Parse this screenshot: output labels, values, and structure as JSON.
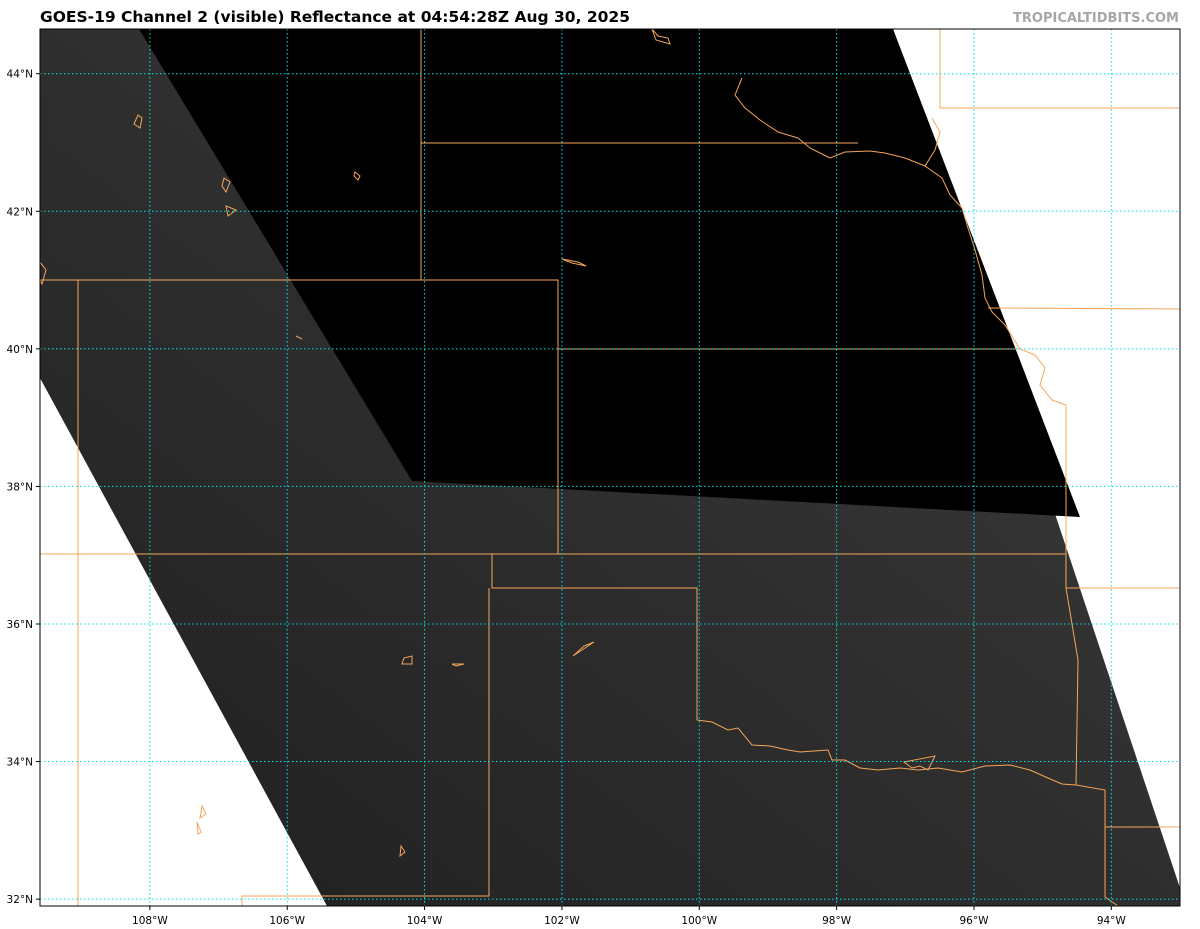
{
  "title": "GOES-19 Channel 2 (visible) Reflectance at 04:54:28Z Aug 30, 2025",
  "credit": "TROPICALTIDBITS.COM",
  "map": {
    "lon_range": [
      -109.6,
      -93.0
    ],
    "lat_range": [
      31.9,
      44.65
    ],
    "longitude_ticks": [
      {
        "value": -108,
        "label": "108°W"
      },
      {
        "value": -106,
        "label": "106°W"
      },
      {
        "value": -104,
        "label": "104°W"
      },
      {
        "value": -102,
        "label": "102°W"
      },
      {
        "value": -100,
        "label": "100°W"
      },
      {
        "value": -98,
        "label": "98°W"
      },
      {
        "value": -96,
        "label": "96°W"
      },
      {
        "value": -94,
        "label": "94°W"
      }
    ],
    "latitude_ticks": [
      {
        "value": 44,
        "label": "44°N"
      },
      {
        "value": 42,
        "label": "42°N"
      },
      {
        "value": 40,
        "label": "40°N"
      },
      {
        "value": 38,
        "label": "38°N"
      },
      {
        "value": 36,
        "label": "36°N"
      },
      {
        "value": 34,
        "label": "34°N"
      },
      {
        "value": 32,
        "label": "32°N"
      }
    ],
    "colors": {
      "gridline": "#00e5ee",
      "boundary": "#f5a55a",
      "no_data": "#ffffff",
      "night": "#000000",
      "imagery_dark": "#222222",
      "imagery_light": "#3c3c3c"
    }
  }
}
